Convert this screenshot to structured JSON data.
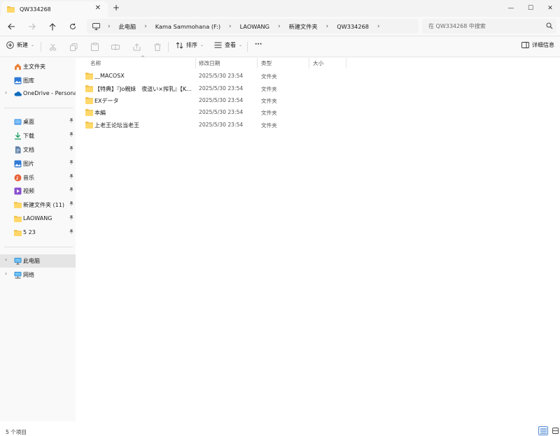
{
  "window": {
    "tab_title": "QW334268",
    "tab_close": "✕",
    "new_tab": "+",
    "minimize": "—",
    "maximize": "☐",
    "close": "✕"
  },
  "address": {
    "crumbs": [
      "此电脑",
      "Kama Sammohana (F:)",
      "LAOWANG",
      "新建文件夹",
      "QW334268"
    ],
    "separator": "›",
    "search_placeholder": "在 QW334268 中搜索"
  },
  "toolbar": {
    "new_label": "新建",
    "sort_label": "排序",
    "view_label": "查看",
    "more_label": "···",
    "details_label": "详细信息",
    "dropdown": "⌄"
  },
  "sidebar": {
    "top_items": [
      {
        "label": "主文件夹",
        "icon": "home-icon"
      },
      {
        "label": "图库",
        "icon": "gallery-icon"
      },
      {
        "label": "OneDrive - Personal",
        "icon": "cloud-icon"
      }
    ],
    "pinned_items": [
      {
        "label": "桌面",
        "icon": "desktop-icon"
      },
      {
        "label": "下载",
        "icon": "download-icon"
      },
      {
        "label": "文档",
        "icon": "document-icon"
      },
      {
        "label": "图片",
        "icon": "pictures-icon"
      },
      {
        "label": "音乐",
        "icon": "music-icon"
      },
      {
        "label": "视频",
        "icon": "video-icon"
      },
      {
        "label": "新建文件夹 (11)",
        "icon": "folder-icon"
      },
      {
        "label": "LAOWANG",
        "icon": "folder-icon"
      },
      {
        "label": "5 23",
        "icon": "folder-icon"
      }
    ],
    "bottom_items": [
      {
        "label": "此电脑",
        "icon": "computer-icon"
      },
      {
        "label": "网络",
        "icon": "network-icon"
      }
    ],
    "expander": "›"
  },
  "columns": {
    "name": "名称",
    "date": "修改日期",
    "type": "类型",
    "size": "大小",
    "sort_indicator": "^"
  },
  "files": [
    {
      "name": "__MACOSX",
      "date": "2025/5/30 23:54",
      "type": "文件夹"
    },
    {
      "name": "【特典】『Jo親妹　夜這い×搾乳』【K...",
      "date": "2025/5/30 23:54",
      "type": "文件夹"
    },
    {
      "name": "EXデータ",
      "date": "2025/5/30 23:54",
      "type": "文件夹"
    },
    {
      "name": "本編",
      "date": "2025/5/30 23:54",
      "type": "文件夹"
    },
    {
      "name": "上老王论坛当老王",
      "date": "2025/5/30 23:54",
      "type": "文件夹"
    }
  ],
  "status": {
    "count_text": "5 个项目"
  },
  "colors": {
    "folder": "#f2c14e",
    "accent": "#0067c0",
    "selected_bg": "#e5e5e5"
  }
}
